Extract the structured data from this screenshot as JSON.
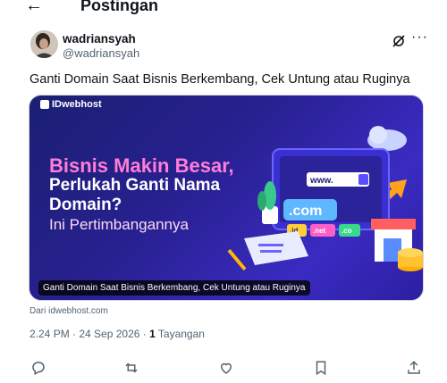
{
  "header": {
    "title": "Postingan"
  },
  "author": {
    "name": "wadriansyah",
    "handle": "@wadriansyah"
  },
  "tweet": {
    "text": "Ganti Domain Saat Bisnis Berkembang, Cek Untung atau Ruginya"
  },
  "card": {
    "brand": "IDwebhost",
    "headline_1": "Bisnis Makin Besar,",
    "headline_2": "Perlukah Ganti Nama Domain?",
    "headline_3": "Ini Pertimbangannya",
    "url_bar": "www.",
    "tld_main": ".com",
    "tld_1": ".id",
    "tld_2": ".net",
    "tld_3": ".co",
    "caption": "Ganti Domain Saat Bisnis Berkembang, Cek Untung atau Ruginya"
  },
  "source": "Dari idwebhost.com",
  "meta": {
    "time": "2.24 PM · 24 Sep 2026 · ",
    "views_count": "1",
    "views_label": " Tayangan"
  },
  "icons": {
    "back": "arrow-left-icon",
    "grok": "grok-icon",
    "more": "more-icon",
    "reply": "reply-icon",
    "retweet": "retweet-icon",
    "like": "heart-icon",
    "bookmark": "bookmark-icon",
    "share": "share-icon"
  },
  "colors": {
    "accent": "#1d9bf0",
    "text": "#0f1419",
    "muted": "#536471"
  }
}
